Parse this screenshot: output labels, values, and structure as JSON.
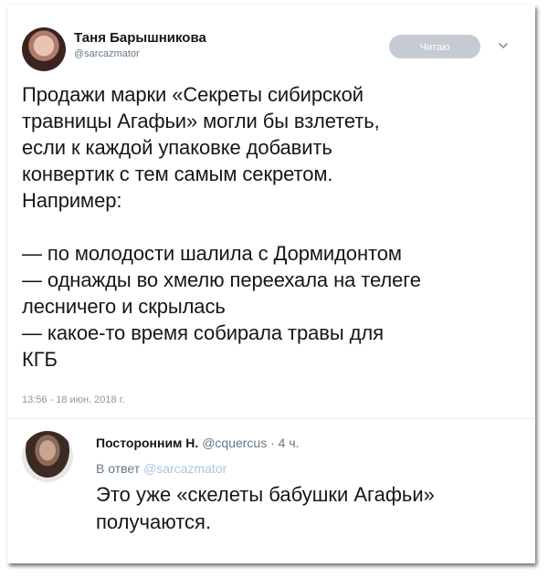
{
  "tweet": {
    "author_name": "Таня Барышникова",
    "author_handle": "@sarcazmator",
    "follow_label": "Читаю",
    "text": "Продажи марки «Секреты сибирской\nтравницы Агафьи» могли бы взлететь,\nесли к каждой упаковке добавить\nконвертик с тем самым секретом.\nНапример:\n\n— по молодости шалила с Дормидонтом\n— однажды во хмелю переехала на телеге\nлесничего и скрылась\n— какое-то время собирала травы для\nКГБ",
    "timestamp": "13:56 - 18 июн. 2018 г."
  },
  "reply": {
    "author_name": "Посторонним Н.",
    "author_handle": "@cquercus",
    "time": "· 4 ч.",
    "reply_prefix": "В ответ",
    "reply_to_handle": "@sarcazmator",
    "text": "Это уже «скелеты бабушки Агафьи» получаются."
  },
  "icons": {
    "menu": "chevron-down-icon"
  }
}
